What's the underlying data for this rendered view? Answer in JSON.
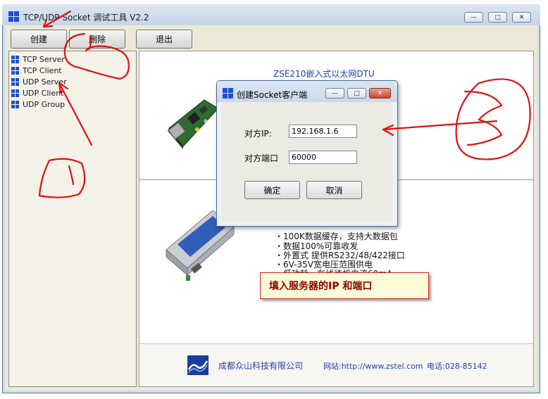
{
  "window": {
    "title": "TCP/UDP Socket 调试工具 V2.2"
  },
  "caption_buttons": [
    "—",
    "□",
    "✕"
  ],
  "toolbar": {
    "create": "创建",
    "delete": "删除",
    "exit": "退出"
  },
  "tree": [
    "TCP Server",
    "TCP Client",
    "UDP Server",
    "UDP Client",
    "UDP Group"
  ],
  "panel": {
    "product_title": "ZSE210嵌入式以太网DTU",
    "features": [
      "・100K数据缓存，支持大数据包",
      "・数据100%可靠收发",
      "・外置式 提供RS232/48/422接口",
      "・6V-35V宽电压范围供电",
      "・低功耗，在线待机电流60mA"
    ]
  },
  "footer": {
    "company": "成都众山科技有限公司",
    "website": "网站:http://www.zstel.com",
    "phone": "电话:028-85142"
  },
  "dialog": {
    "title": "创建Socket客户端",
    "ip_label": "对方IP:",
    "ip_value": "192.168.1.6",
    "port_label": "对方端口",
    "port_value": "60000",
    "ok": "确定",
    "cancel": "取消"
  },
  "callout": "填入服务器的IP 和端口",
  "colors": {
    "annotation_red": "#e01010",
    "link_blue": "#1f3fa8"
  }
}
